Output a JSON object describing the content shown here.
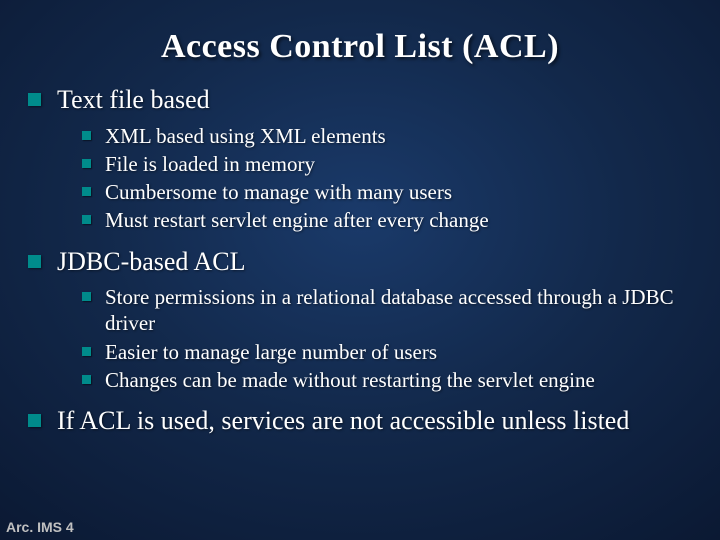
{
  "title": "Access Control List (ACL)",
  "items": [
    {
      "text": "Text file based",
      "sub": [
        "XML based using XML elements",
        "File is loaded in memory",
        "Cumbersome to manage with many users",
        "Must restart servlet engine after every change"
      ]
    },
    {
      "text": "JDBC-based ACL",
      "sub": [
        "Store permissions in a relational database accessed through a JDBC driver",
        "Easier to manage large number of users",
        "Changes can be made without restarting the servlet engine"
      ]
    },
    {
      "text": "If ACL is used, services are not accessible unless listed",
      "sub": []
    }
  ],
  "footer": "Arc. IMS 4"
}
